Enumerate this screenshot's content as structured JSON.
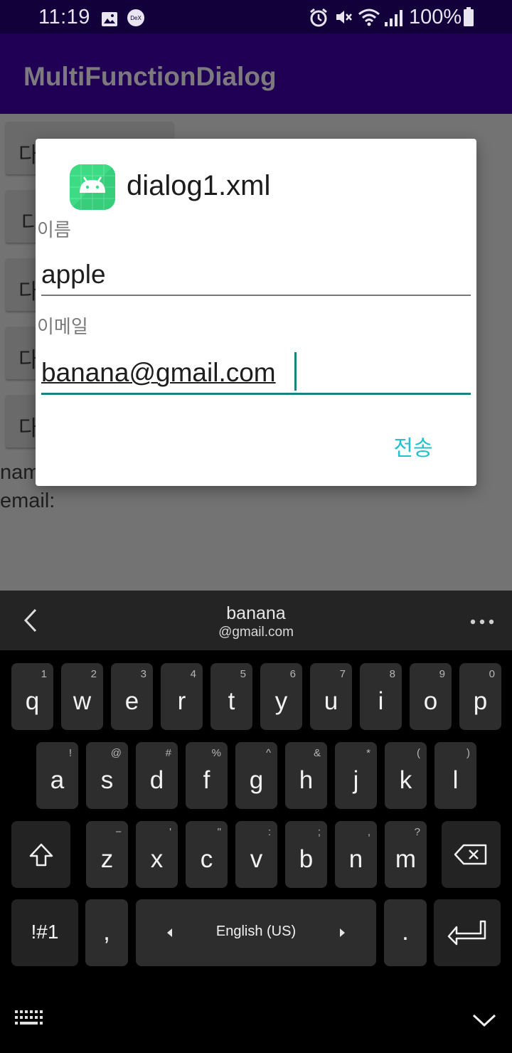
{
  "status_bar": {
    "time": "11:19",
    "battery": "100%"
  },
  "app_bar": {
    "title": "MultiFunctionDialog"
  },
  "background": {
    "button_label": "다",
    "name_label": "nam",
    "email_label": "email:"
  },
  "dialog": {
    "title": "dialog1.xml",
    "name_label": "이름",
    "name_value": "apple",
    "email_label": "이메일",
    "email_value": "banana@gmail.com",
    "send_label": "전송"
  },
  "suggestion_bar": {
    "word1": "banana",
    "word2": "@gmail.com"
  },
  "keyboard": {
    "row1": [
      {
        "k": "q",
        "h": "1"
      },
      {
        "k": "w",
        "h": "2"
      },
      {
        "k": "e",
        "h": "3"
      },
      {
        "k": "r",
        "h": "4"
      },
      {
        "k": "t",
        "h": "5"
      },
      {
        "k": "y",
        "h": "6"
      },
      {
        "k": "u",
        "h": "7"
      },
      {
        "k": "i",
        "h": "8"
      },
      {
        "k": "o",
        "h": "9"
      },
      {
        "k": "p",
        "h": "0"
      }
    ],
    "row2": [
      {
        "k": "a",
        "h": "!"
      },
      {
        "k": "s",
        "h": "@"
      },
      {
        "k": "d",
        "h": "#"
      },
      {
        "k": "f",
        "h": "%"
      },
      {
        "k": "g",
        "h": "^"
      },
      {
        "k": "h",
        "h": "&"
      },
      {
        "k": "j",
        "h": "*"
      },
      {
        "k": "k",
        "h": "("
      },
      {
        "k": "l",
        "h": ")"
      }
    ],
    "row3": [
      {
        "k": "z",
        "h": "−"
      },
      {
        "k": "x",
        "h": "'"
      },
      {
        "k": "c",
        "h": "\""
      },
      {
        "k": "v",
        "h": ":"
      },
      {
        "k": "b",
        "h": ";"
      },
      {
        "k": "n",
        "h": ","
      },
      {
        "k": "m",
        "h": "?"
      }
    ],
    "symbols_label": "!#1",
    "comma_label": ",",
    "space_label": "English (US)",
    "period_label": "."
  },
  "colors": {
    "status_bar": "#12003a",
    "app_bar": "#200055",
    "accent": "#21c2c9",
    "field_active": "#1e8080"
  },
  "icons": [
    "gallery-icon",
    "dex-icon",
    "alarm-icon",
    "mute-icon",
    "wifi-icon",
    "signal-icon",
    "battery-icon",
    "android-app-icon",
    "back-icon",
    "more-icon",
    "shift-icon",
    "backspace-icon",
    "enter-icon",
    "keyboard-icon",
    "collapse-icon"
  ]
}
